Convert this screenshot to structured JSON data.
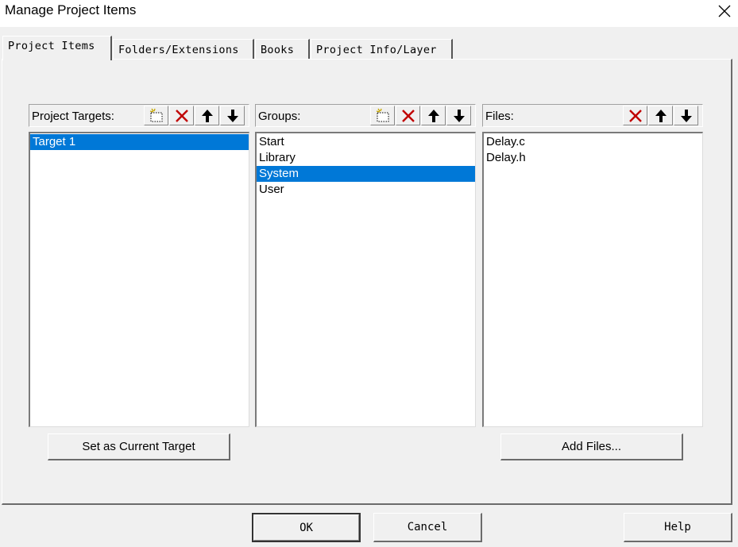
{
  "window": {
    "title": "Manage Project Items"
  },
  "tabs": [
    {
      "label": "Project Items"
    },
    {
      "label": "Folders/Extensions"
    },
    {
      "label": "Books"
    },
    {
      "label": "Project Info/Layer"
    }
  ],
  "targets": {
    "header": "Project Targets:",
    "items": [
      "Target 1"
    ],
    "selected_index": 0
  },
  "groups": {
    "header": "Groups:",
    "items": [
      "Start",
      "Library",
      "System",
      "User"
    ],
    "selected_index": 2
  },
  "files": {
    "header": "Files:",
    "items": [
      "Delay.c",
      "Delay.h"
    ]
  },
  "buttons": {
    "set_current": "Set as Current Target",
    "add_files": "Add Files...",
    "ok": "OK",
    "cancel": "Cancel",
    "help": "Help"
  },
  "icons": {
    "new": "new-item-icon",
    "delete": "delete-icon",
    "up": "move-up-icon",
    "down": "move-down-icon",
    "close": "close-icon"
  },
  "colors": {
    "selection": "#0078d7",
    "delete_red": "#c00000"
  }
}
